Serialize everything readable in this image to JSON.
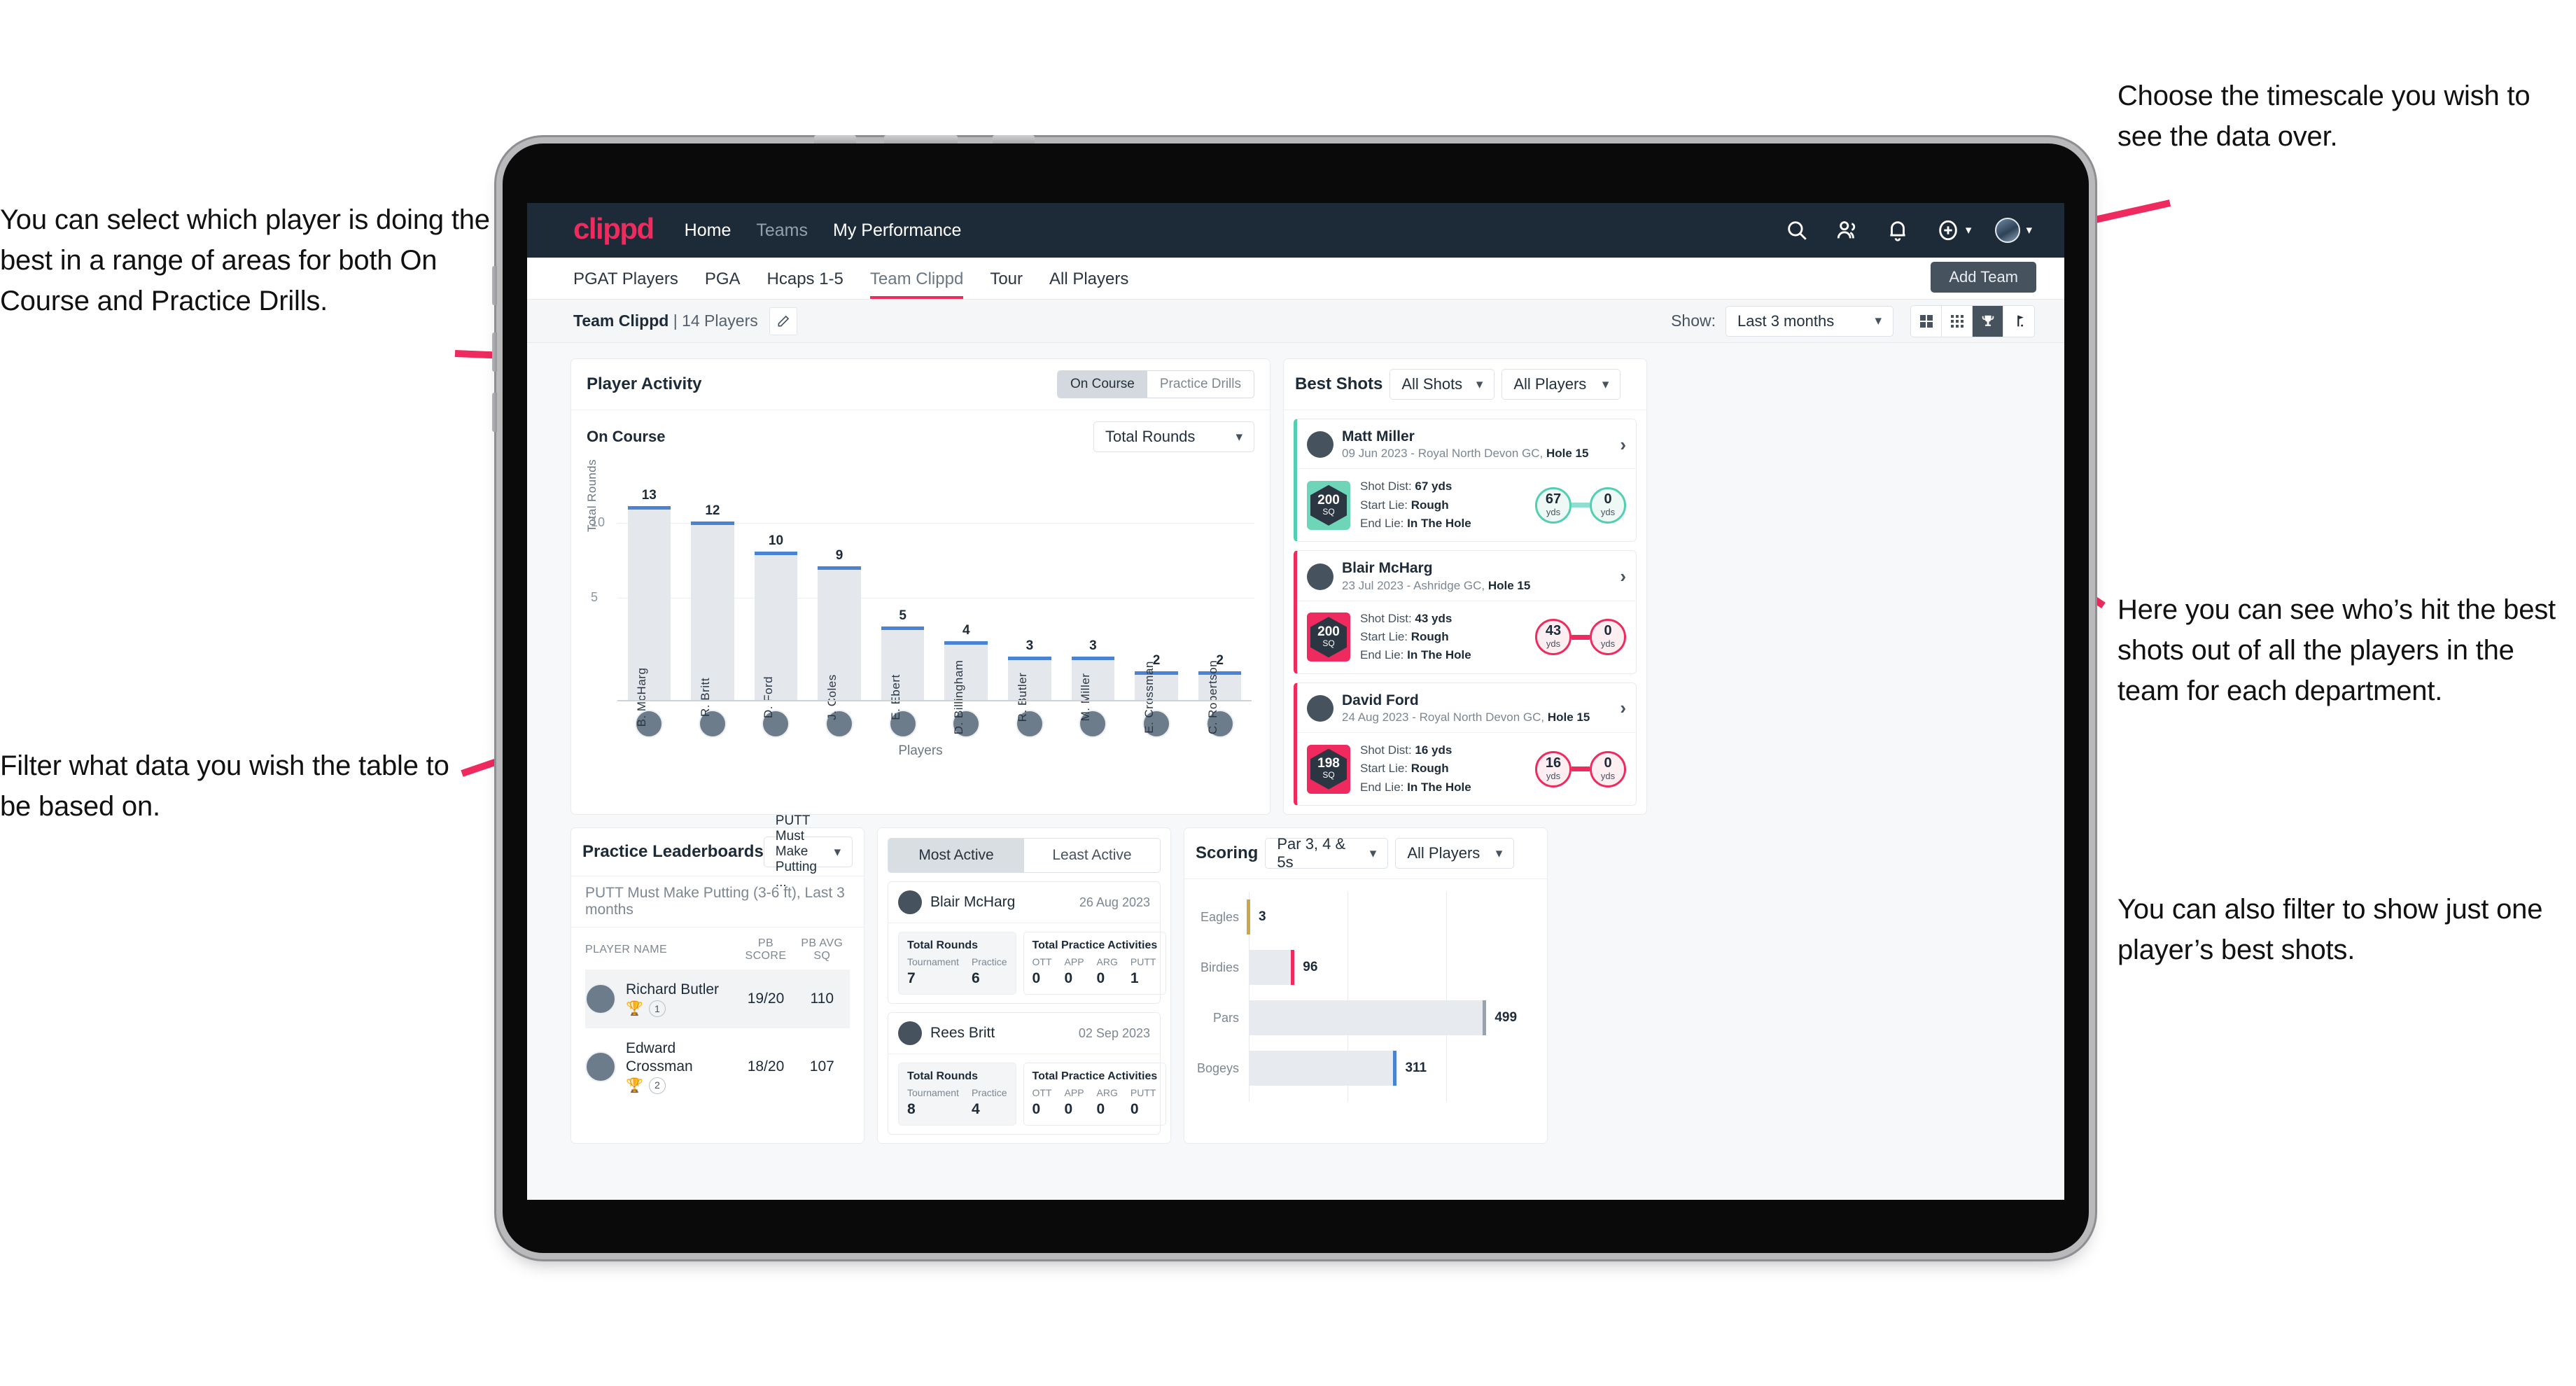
{
  "annotations": {
    "left_top": "You can select which player is doing the best in a range of areas for both On Course and Practice Drills.",
    "left_bottom": "Filter what data you wish the table to be based on.",
    "right_top": "Choose the timescale you wish to see the data over.",
    "right_middle": "Here you can see who’s hit the best shots out of all the players in the team for each department.",
    "right_bottom": "You can also filter to show just one player’s best shots."
  },
  "topnav": {
    "brand": "clippd",
    "links": [
      {
        "label": "Home",
        "active": true
      },
      {
        "label": "Teams",
        "active": false
      },
      {
        "label": "My Performance",
        "active": true
      }
    ],
    "icons": [
      "search-icon",
      "people-icon",
      "bell-icon",
      "plus-circle-icon",
      "avatar"
    ]
  },
  "tabs": [
    {
      "label": "PGAT Players",
      "active": false
    },
    {
      "label": "PGA",
      "active": false
    },
    {
      "label": "Hcaps 1-5",
      "active": false
    },
    {
      "label": "Team Clippd",
      "active": true
    },
    {
      "label": "Tour",
      "active": false
    },
    {
      "label": "All Players",
      "active": false
    }
  ],
  "add_team_button": "Add Team",
  "toolbar": {
    "team_name": "Team Clippd",
    "team_separator": " | ",
    "player_count": "14 Players",
    "show_label": "Show:",
    "timescale_value": "Last 3 months",
    "view_buttons": [
      "grid-large-icon",
      "grid-small-icon",
      "trophy-icon",
      "flag-icon"
    ],
    "active_view": "trophy-icon"
  },
  "player_activity": {
    "title": "Player Activity",
    "segments": [
      {
        "label": "On Course",
        "active": true
      },
      {
        "label": "Practice Drills",
        "active": false
      }
    ],
    "subtitle": "On Course",
    "metric_value": "Total Rounds"
  },
  "chart_data": [
    {
      "type": "bar",
      "title": "Player Activity – On Course",
      "xlabel": "Players",
      "ylabel": "Total Rounds",
      "ylim": [
        0,
        14
      ],
      "yticks": [
        5,
        10
      ],
      "grid": true,
      "categories": [
        "B. McHarg",
        "R. Britt",
        "D. Ford",
        "J. Coles",
        "E. Ebert",
        "D. Billingham",
        "R. Butler",
        "M. Miller",
        "E. Crossman",
        "C. Robertson"
      ],
      "values": [
        13,
        12,
        10,
        9,
        5,
        4,
        3,
        3,
        2,
        2
      ]
    },
    {
      "type": "bar",
      "orientation": "horizontal",
      "title": "Scoring",
      "xlabel": "",
      "ylabel": "",
      "xlim": [
        0,
        600
      ],
      "categories": [
        "Eagles",
        "Birdies",
        "Pars",
        "Bogeys"
      ],
      "values": [
        3,
        96,
        499,
        311
      ],
      "colors": [
        "#c9a84c",
        "#ee2a5e",
        "#9aa3ac",
        "#4a83d4"
      ]
    }
  ],
  "best_shots": {
    "title": "Best Shots",
    "filter_shots": "All Shots",
    "filter_players": "All Players",
    "cards": [
      {
        "accent": "teal",
        "player": "Matt Miller",
        "meta_prefix": "09 Jun 2023 - Royal North Devon GC, ",
        "meta_hole": "Hole 15",
        "badge_value": "200",
        "badge_unit": "SQ",
        "shot_dist_label": "Shot Dist: ",
        "shot_dist": "67 yds",
        "start_lie_label": "Start Lie: ",
        "start_lie": "Rough",
        "end_lie_label": "End Lie: ",
        "end_lie": "In The Hole",
        "from_value": "67",
        "from_unit": "yds",
        "to_value": "0",
        "to_unit": "yds"
      },
      {
        "accent": "pink",
        "player": "Blair McHarg",
        "meta_prefix": "23 Jul 2023 - Ashridge GC, ",
        "meta_hole": "Hole 15",
        "badge_value": "200",
        "badge_unit": "SQ",
        "shot_dist_label": "Shot Dist: ",
        "shot_dist": "43 yds",
        "start_lie_label": "Start Lie: ",
        "start_lie": "Rough",
        "end_lie_label": "End Lie: ",
        "end_lie": "In The Hole",
        "from_value": "43",
        "from_unit": "yds",
        "to_value": "0",
        "to_unit": "yds"
      },
      {
        "accent": "pink",
        "player": "David Ford",
        "meta_prefix": "24 Aug 2023 - Royal North Devon GC, ",
        "meta_hole": "Hole 15",
        "badge_value": "198",
        "badge_unit": "SQ",
        "shot_dist_label": "Shot Dist: ",
        "shot_dist": "16 yds",
        "start_lie_label": "Start Lie: ",
        "start_lie": "Rough",
        "end_lie_label": "End Lie: ",
        "end_lie": "In The Hole",
        "from_value": "16",
        "from_unit": "yds",
        "to_value": "0",
        "to_unit": "yds"
      }
    ]
  },
  "practice_leaderboards": {
    "title": "Practice Leaderboards",
    "drill_select": "PUTT Must Make Putting ...",
    "subtitle_bold": "PUTT Must Make Putting (3-6 ft),",
    "subtitle_light": " Last 3 months",
    "columns": [
      "PLAYER NAME",
      "PB SCORE",
      "PB AVG SQ"
    ],
    "rows": [
      {
        "name": "Richard Butler",
        "rank": "1",
        "medal": "gold",
        "pb_score": "19/20",
        "pb_avg_sq": "110",
        "highlight": true
      },
      {
        "name": "Edward Crossman",
        "rank": "2",
        "medal": "silver",
        "pb_score": "18/20",
        "pb_avg_sq": "107",
        "highlight": false
      }
    ]
  },
  "activity": {
    "tabs": [
      {
        "label": "Most Active",
        "active": true
      },
      {
        "label": "Least Active",
        "active": false
      }
    ],
    "cards": [
      {
        "player": "Blair McHarg",
        "date": "26 Aug 2023",
        "rounds_title": "Total Rounds",
        "rounds_cols": [
          "Tournament",
          "Practice"
        ],
        "rounds_vals": [
          "7",
          "6"
        ],
        "practice_title": "Total Practice Activities",
        "practice_cols": [
          "OTT",
          "APP",
          "ARG",
          "PUTT"
        ],
        "practice_vals": [
          "0",
          "0",
          "0",
          "1"
        ]
      },
      {
        "player": "Rees Britt",
        "date": "02 Sep 2023",
        "rounds_title": "Total Rounds",
        "rounds_cols": [
          "Tournament",
          "Practice"
        ],
        "rounds_vals": [
          "8",
          "4"
        ],
        "practice_title": "Total Practice Activities",
        "practice_cols": [
          "OTT",
          "APP",
          "ARG",
          "PUTT"
        ],
        "practice_vals": [
          "0",
          "0",
          "0",
          "0"
        ]
      }
    ]
  },
  "scoring": {
    "title": "Scoring",
    "filter_par": "Par 3, 4 & 5s",
    "filter_players": "All Players"
  }
}
